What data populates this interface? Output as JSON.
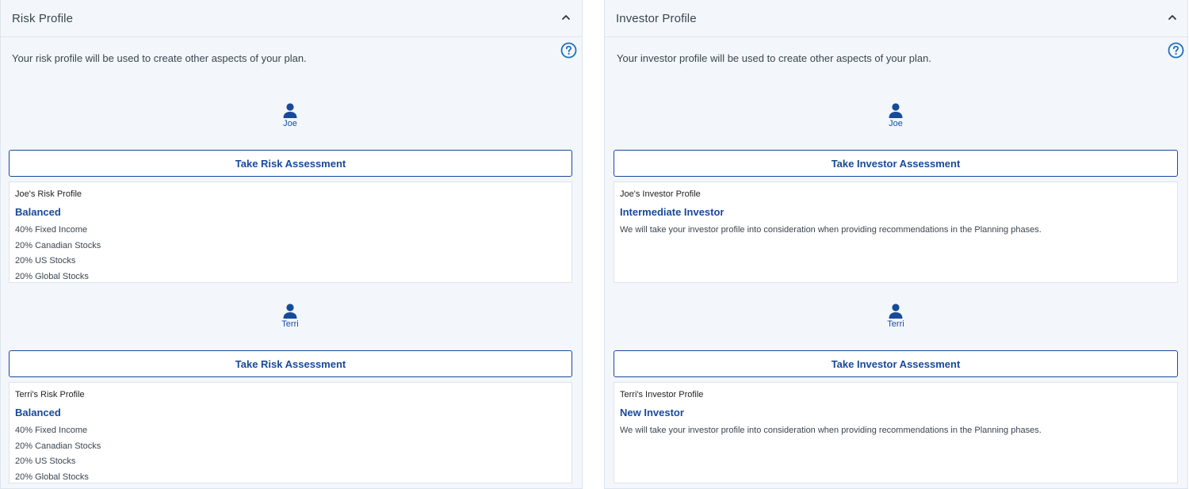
{
  "risk_panel": {
    "title": "Risk Profile",
    "description": "Your risk profile will be used to create other aspects of your plan.",
    "people": [
      {
        "name": "Joe",
        "button_label": "Take Risk Assessment",
        "card_heading": "Joe's Risk Profile",
        "profile": "Balanced",
        "allocations": [
          "40% Fixed Income",
          "20% Canadian Stocks",
          "20% US Stocks",
          "20% Global Stocks"
        ]
      },
      {
        "name": "Terri",
        "button_label": "Take Risk Assessment",
        "card_heading": "Terri's Risk Profile",
        "profile": "Balanced",
        "allocations": [
          "40% Fixed Income",
          "20% Canadian Stocks",
          "20% US Stocks",
          "20% Global Stocks"
        ]
      }
    ]
  },
  "investor_panel": {
    "title": "Investor Profile",
    "description": "Your investor profile will be used to create other aspects of your plan.",
    "people": [
      {
        "name": "Joe",
        "button_label": "Take Investor Assessment",
        "card_heading": "Joe's Investor Profile",
        "profile": "Intermediate Investor",
        "note": "We will take your investor profile into consideration when providing recommendations in the Planning phases."
      },
      {
        "name": "Terri",
        "button_label": "Take Investor Assessment",
        "card_heading": "Terri's Investor Profile",
        "profile": "New Investor",
        "note": "We will take your investor profile into consideration when providing recommendations in the Planning phases."
      }
    ]
  },
  "icons": {
    "collapse": "chevron-up-icon",
    "help": "help-circle-icon",
    "person": "person-icon"
  },
  "colors": {
    "accent": "#174a98",
    "panel_bg": "#f3f7fb",
    "border": "#dce4ec"
  }
}
